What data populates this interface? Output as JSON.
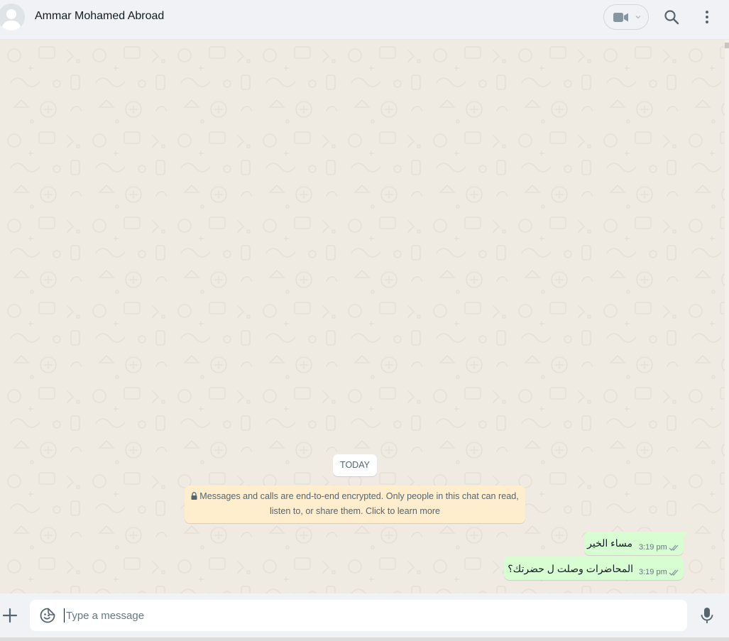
{
  "header": {
    "contact_name": "Ammar Mohamed Abroad",
    "avatar_icon": "default-avatar-icon",
    "video_call_icon": "video-camera-icon",
    "search_icon": "search-icon",
    "menu_icon": "vertical-dots-icon"
  },
  "chat": {
    "day_label": "TODAY",
    "encryption_notice": {
      "line1": "Messages and calls are end-to-end encrypted. Only people in this chat can read,",
      "line2": "listen to, or share them. Click to learn more",
      "icon": "lock-icon"
    },
    "messages": [
      {
        "text": "مساء الخير",
        "time": "3:19 pm",
        "status": "read-double-check"
      },
      {
        "text": "المحاضرات وصلت ل حضرتك؟",
        "time": "3:19 pm",
        "status": "read-double-check"
      }
    ]
  },
  "composer": {
    "placeholder": "Type a message",
    "value": "",
    "attach_icon": "plus-icon",
    "emoji_icon": "emoji-sticker-icon",
    "mic_icon": "microphone-icon"
  },
  "colors": {
    "header_bg": "#f0f2f5",
    "chat_bg": "#efeae2",
    "outgoing_bubble": "#d9fdd3",
    "encryption_notice_bg": "#ffeecd",
    "tick_color": "#8696a0"
  }
}
